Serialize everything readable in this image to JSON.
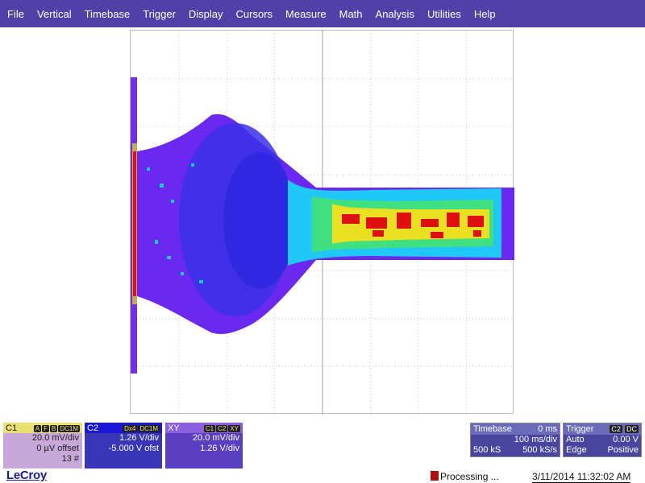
{
  "menu": [
    "File",
    "Vertical",
    "Timebase",
    "Trigger",
    "Display",
    "Cursors",
    "Measure",
    "Math",
    "Analysis",
    "Utilities",
    "Help"
  ],
  "colors": {
    "menubar": "#5040a8",
    "trace_low": "#6030e0",
    "trace_mid": "#10c0ff",
    "trace_high": "#e01010"
  },
  "channel1": {
    "name": "C1",
    "tags": [
      "A",
      "F",
      "B",
      "DC1M"
    ],
    "vdiv": "20.0 mV/div",
    "offset": "0 µV offset",
    "count": "13 #"
  },
  "channel2": {
    "name": "C2",
    "tags": [
      "Dx4",
      "DC1M"
    ],
    "vdiv": "1.26 V/div",
    "offset": "-5.000 V ofst"
  },
  "xy": {
    "name": "XY",
    "tags": [
      "C1",
      "C2",
      "XY"
    ],
    "vdiv": "20.0 mV/div",
    "hdiv": "1.26 V/div"
  },
  "timebase": {
    "label": "Timebase",
    "delay": "0 ms",
    "tdiv": "100 ms/div",
    "samples": "500 kS",
    "rate": "500 kS/s"
  },
  "trigger": {
    "label": "Trigger",
    "source": "C2",
    "coupling": "DC",
    "mode": "Auto",
    "level": "0.00 V",
    "type": "Edge",
    "slope": "Positive"
  },
  "brand": "LeCroy",
  "status": "Processing ...",
  "datetime": "3/11/2014 11:32:02 AM"
}
